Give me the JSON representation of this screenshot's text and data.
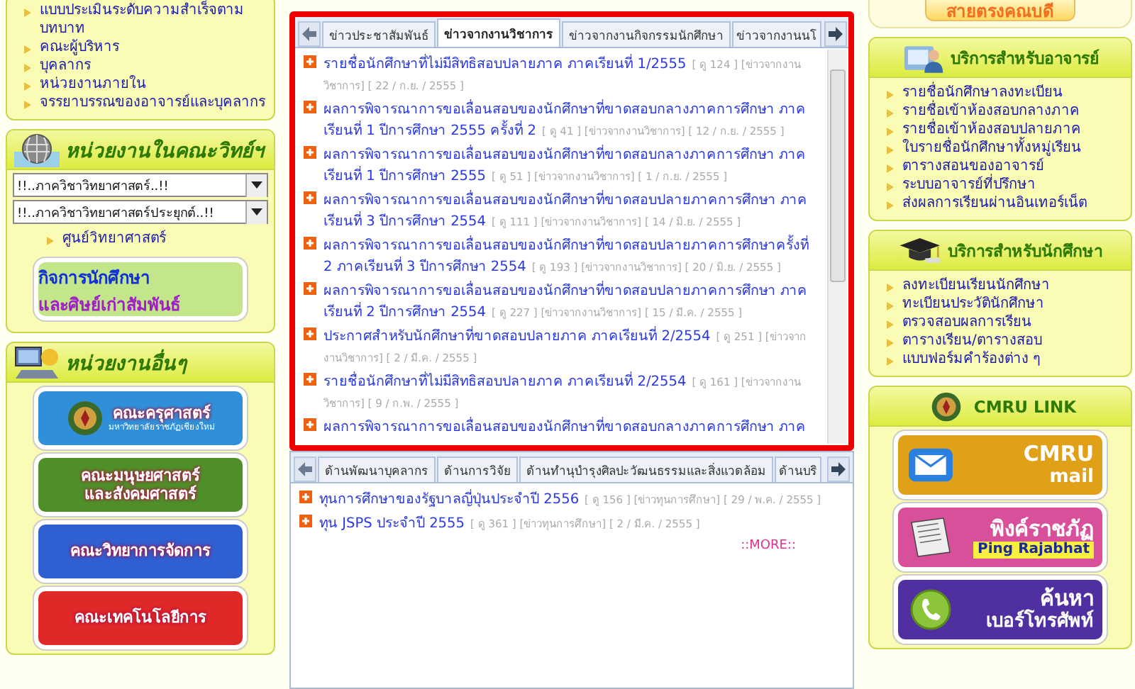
{
  "left": {
    "intro_links": [
      "แบบประเมินระดับความสำเร็จตามบทบาท",
      "คณะผู้บริหาร",
      "บุคลากร",
      "หน่วยงานภายใน",
      "จรรยาบรรณของอาจารย์และบุคลากร"
    ],
    "units_panel": {
      "title": "หน่วยงานในคณะวิทย์ฯ",
      "selects": [
        {
          "value": "!!..ภาควิชาวิทยาศาสตร์..!!"
        },
        {
          "value": "!!..ภาควิชาวิทยาศาสตร์ประยุกต์..!!"
        }
      ],
      "links": [
        "ศูนย์วิทยาศาสตร์"
      ],
      "banner": {
        "lines": [
          "กิจการนักศึกษา",
          "และศิษย์เก่าสัมพันธ์"
        ],
        "color": "#c4e68a"
      }
    },
    "others_panel": {
      "title": "หน่วยงานอื่นๆ",
      "banners": [
        {
          "lines": [
            "คณะครุศาสตร์",
            "มหาวิทยาลัยราชภัฏเชียงใหม่"
          ],
          "color": "#2f8fd8"
        },
        {
          "lines": [
            "คณะมนุษยศาสตร์",
            "และสังคมศาสตร์"
          ],
          "color": "#4f8f2a"
        },
        {
          "lines": [
            "คณะวิทยาการจัดการ"
          ],
          "color": "#2f5fd0"
        },
        {
          "lines": [
            "คณะเทคโนโลยีการ"
          ],
          "color": "#e02828"
        }
      ]
    }
  },
  "news_top": {
    "tabs": [
      {
        "label": "ข่าวประชาสัมพันธ์",
        "selected": false
      },
      {
        "label": "ข่าวจากงานวิชาการ",
        "selected": true
      },
      {
        "label": "ข่าวจากงานกิจกรรมนักศึกษา",
        "selected": false
      },
      {
        "label": "ข่าวจากงานนโ",
        "selected": false
      }
    ],
    "items": [
      {
        "title": "รายชื่อนักศึกษาที่ไม่มีสิทธิสอบปลายภาค ภาคเรียนที่ 1/2555",
        "meta": "[ ดู 124 ] [ข่าวจากงานวิชาการ] [ 22 / ก.ย. / 2555 ]"
      },
      {
        "title": "ผลการพิจารณาการขอเลื่อนสอบของนักศึกษาที่ขาดสอบกลางภาคการศึกษา ภาคเรียนที่ 1 ปีการศึกษา 2555 ครั้งที่ 2",
        "meta": "[ ดู 41 ] [ข่าวจากงานวิชาการ] [ 12 / ก.ย. / 2555 ]"
      },
      {
        "title": "ผลการพิจารณาการขอเลื่อนสอบของนักศึกษาที่ขาดสอบกลางภาคการศึกษา ภาคเรียนที่ 1 ปีการศึกษา 2555",
        "meta": "[ ดู 51 ] [ข่าวจากงานวิชาการ] [ 1 / ก.ย. / 2555 ]"
      },
      {
        "title": "ผลการพิจารณาการขอเลื่อนสอบของนักศึกษาที่ขาดสอบปลายภาคการศึกษา ภาคเรียนที่ 3 ปีการศึกษา 2554",
        "meta": "[ ดู 111 ] [ข่าวจากงานวิชาการ] [ 14 / มิ.ย. / 2555 ]"
      },
      {
        "title": "ผลการพิจารณาการขอเลื่อนสอบของนักศึกษาที่ขาดสอบปลายภาคการศึกษาครั้งที่ 2 ภาคเรียนที่ 3 ปีการศึกษา 2554",
        "meta": "[ ดู 193 ] [ข่าวจากงานวิชาการ] [ 20 / มิ.ย. / 2555 ]"
      },
      {
        "title": "ผลการพิจารณาการขอเลื่อนสอบของนักศึกษาที่ขาดสอบปลายภาคการศึกษา ภาคเรียนที่ 2 ปีการศึกษา 2554",
        "meta": "[ ดู 227 ] [ข่าวจากงานวิชาการ] [ 15 / มี.ค. / 2555 ]"
      },
      {
        "title": "ประกาศสำหรับนักศึกษาที่ขาดสอบปลายภาค ภาคเรียนที่ 2/2554",
        "meta": "[ ดู 251 ] [ข่าวจากงานวิชาการ] [ 2 / มี.ค. / 2555 ]"
      },
      {
        "title": "รายชื่อนักศึกษาที่ไม่มีสิทธิสอบปลายภาค ภาคเรียนที่ 2/2554",
        "meta": "[ ดู 161 ] [ข่าวจากงานวิชาการ] [ 9 / ก.พ. / 2555 ]"
      },
      {
        "title": "ผลการพิจารณาการขอเลื่อนสอบของนักศึกษาที่ขาดสอบกลางภาคการศึกษา ภาค"
      }
    ]
  },
  "news_bottom": {
    "tabs": [
      {
        "label": "ด้านพัฒนาบุคลากร",
        "selected": false
      },
      {
        "label": "ด้านการวิจัย",
        "selected": false
      },
      {
        "label": "ด้านทำนุบำรุงศิลปะวัฒนธรรมและสิ่งแวดล้อม",
        "selected": false
      },
      {
        "label": "ด้านบริ",
        "selected": false
      }
    ],
    "items": [
      {
        "title": "ทุนการศึกษาของรัฐบาลญี่ปุ่นประจำปี 2556",
        "meta": "[ ดู 156 ] [ข่าวทุนการศึกษา] [ 29 / พ.ค. / 2555 ]"
      },
      {
        "title": "ทุน JSPS ประจำปี 2555",
        "meta": "[ ดู 361 ] [ข่าวทุนการศึกษา] [ 2 / มี.ค. / 2555 ]"
      }
    ],
    "more": "::MORE::"
  },
  "right": {
    "dean_button": "สายตรงคณบดี",
    "teacher_panel": {
      "title": "บริการสำหรับอาจารย์",
      "links": [
        "รายชื่อนักศึกษาลงทะเบียน",
        "รายชื่อเข้าห้องสอบกลางภาค",
        "รายชื่อเข้าห้องสอบปลายภาค",
        "ใบรายชื่อนักศึกษาทั้งหมู่เรียน",
        "ตารางสอนของอาจารย์",
        "ระบบอาจารย์ที่ปรึกษา",
        "ส่งผลการเรียนผ่านอินเทอร์เน็ต"
      ]
    },
    "student_panel": {
      "title": "บริการสำหรับนักศึกษา",
      "links": [
        "ลงทะเบียนเรียนนักศึกษา",
        "ทะเบียนประวัตินักศึกษา",
        "ตรวจสอบผลการเรียน",
        "ตารางเรียน/ตารางสอบ",
        "แบบฟอร์มคำร้องต่าง ๆ"
      ]
    },
    "link_panel": {
      "title": "CMRU LINK",
      "banners": [
        {
          "lines": [
            "CMRU",
            "mail"
          ],
          "color": "#e0a018"
        },
        {
          "lines": [
            "พิงค์ราชภัฏ",
            "Ping Rajabhat"
          ],
          "color": "#d8509a"
        },
        {
          "lines": [
            "ค้นหา",
            "เบอร์โทรศัพท์"
          ],
          "color": "#5030a0"
        }
      ]
    }
  }
}
